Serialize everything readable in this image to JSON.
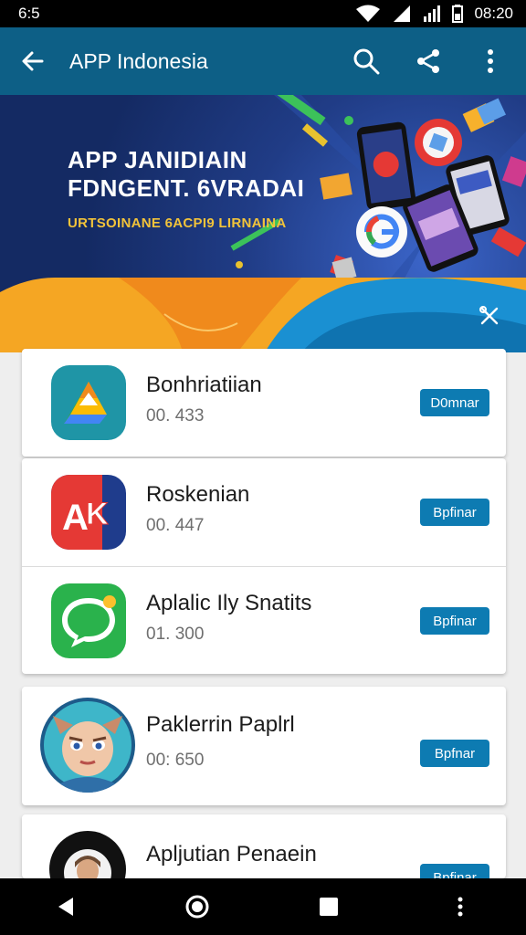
{
  "status_bar": {
    "left_time": "6:5",
    "right_time": "08:20"
  },
  "app_bar": {
    "title": "APP Indonesia"
  },
  "banner": {
    "line1": "APP JANIDIAIN",
    "line2": "FDNGENT. 6VRADAI",
    "line3": "URTSOINANE 6ACPI9 LIRNAINA"
  },
  "apps": [
    {
      "name": "Bonhriatiian",
      "meta": "00. 433",
      "action": "D0mnar",
      "icon": "drive-triangle-icon"
    },
    {
      "name": "Roskenian",
      "meta": "00. 447",
      "action": "Bpfinar",
      "icon": "ax-letter-icon"
    },
    {
      "name": "Aplalic Ily Snatits",
      "meta": "01. 300",
      "action": "Bpfinar",
      "icon": "chat-bubble-icon"
    },
    {
      "name": "Paklerrin Paplrl",
      "meta": "00: 650",
      "action": "Bpfnar",
      "icon": "cartoon-face-icon"
    },
    {
      "name": "Apljutian Penaein",
      "action": "Bpfinar",
      "icon": "portrait-icon"
    }
  ],
  "colors": {
    "app_bar": "#0d5f86",
    "button": "#0d7bb2",
    "banner_accent": "#f2c33a"
  }
}
